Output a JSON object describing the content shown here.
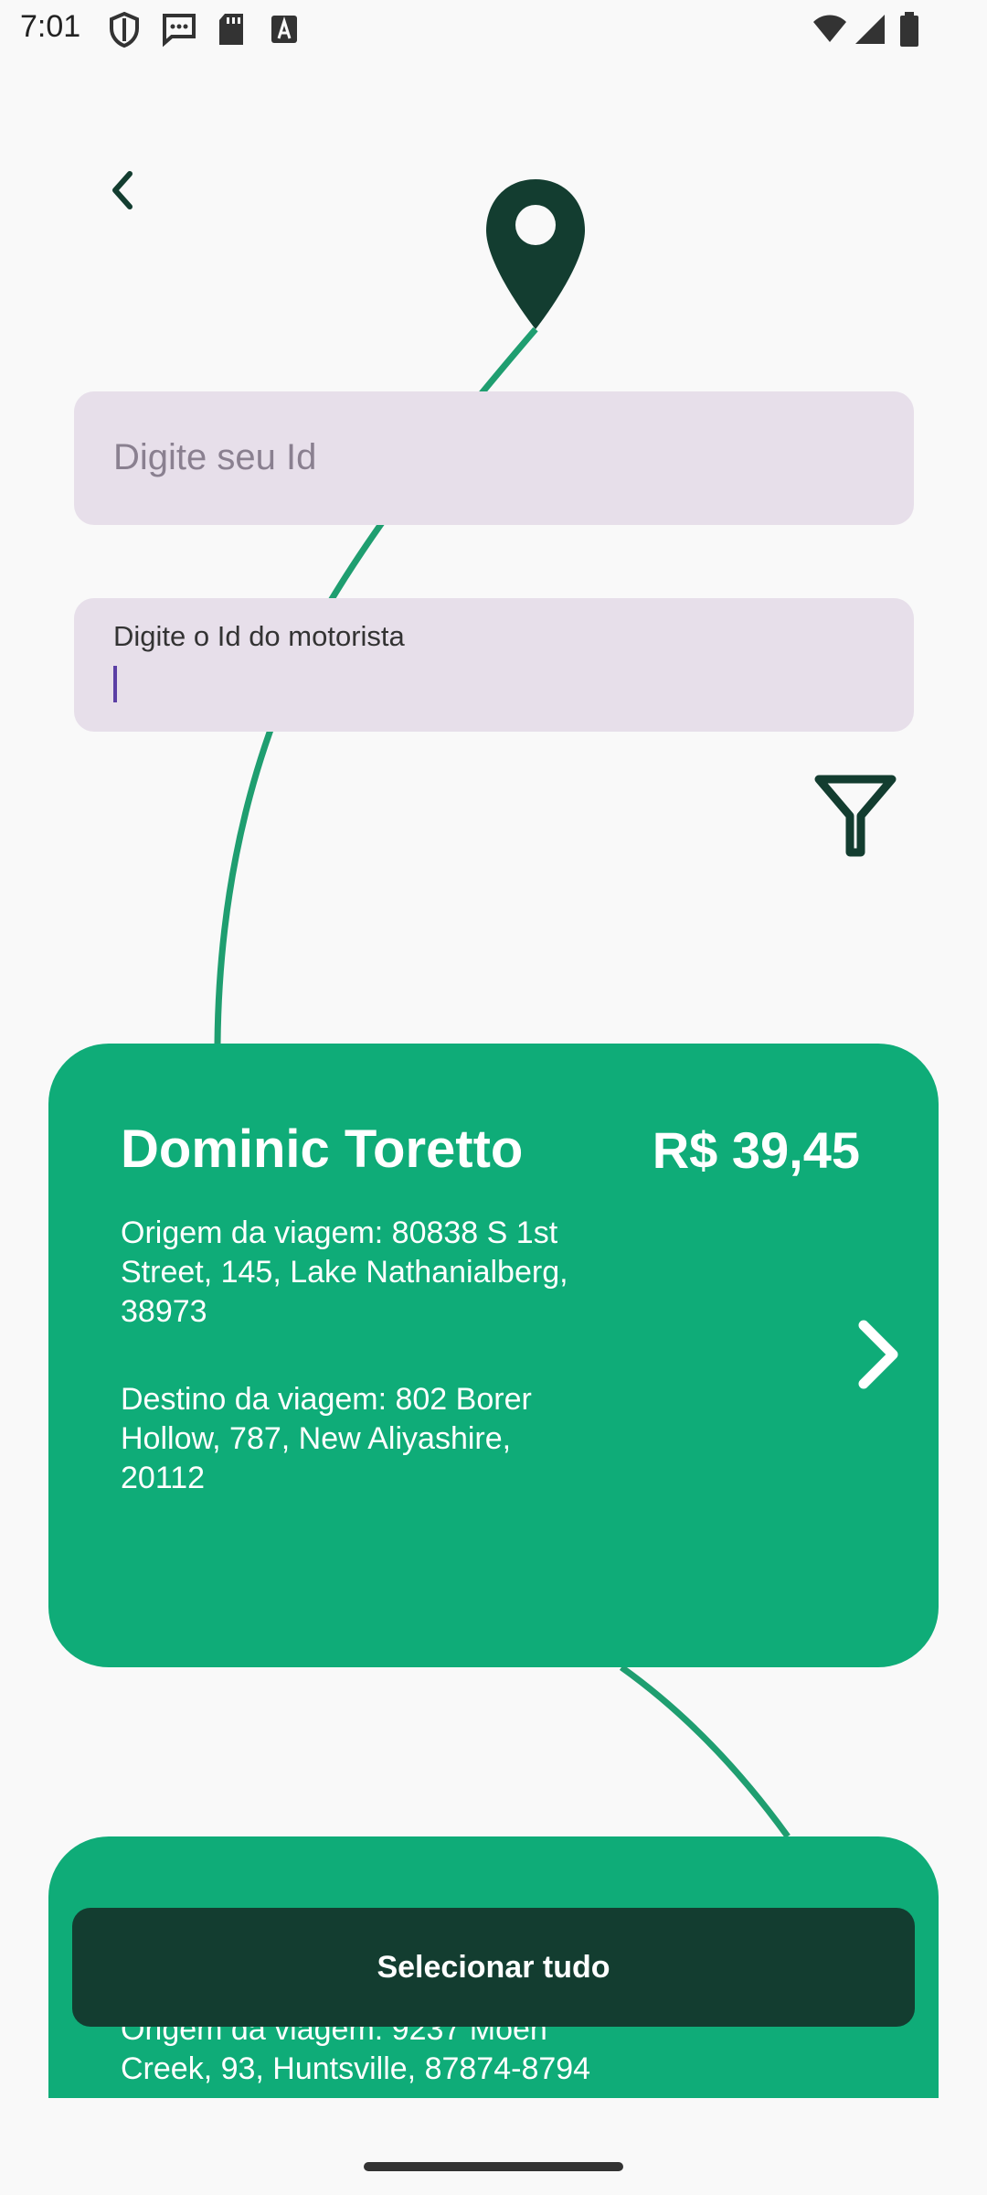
{
  "status_bar": {
    "time": "7:01",
    "left_icons": [
      "shield-icon",
      "message-icon",
      "sd-card-icon",
      "font-icon"
    ],
    "right_icons": [
      "wifi-icon",
      "signal-icon",
      "battery-icon"
    ]
  },
  "colors": {
    "accent": "#0fac78",
    "dark": "#133d30",
    "field_bg": "#e7dfea",
    "caret": "#5b3fa5"
  },
  "header": {
    "back_icon": "chevron-left-icon",
    "pin_icon": "map-pin-icon"
  },
  "form": {
    "user_id": {
      "placeholder": "Digite seu Id",
      "value": ""
    },
    "driver_id": {
      "label": "Digite o Id do motorista",
      "value": ""
    },
    "filter_icon": "filter-icon"
  },
  "rides": [
    {
      "driver": "Dominic Toretto",
      "price": "R$ 39,45",
      "origin": "Origem da viagem: 80838 S 1st Street, 145, Lake Nathanialberg, 38973",
      "destination": "Destino da viagem: 802 Borer Hollow, 787, New Aliyashire, 20112"
    },
    {
      "origin": "Origem da viagem: 9237 Moen Creek, 93, Huntsville, 87874-8794"
    }
  ],
  "actions": {
    "select_all_label": "Selecionar tudo"
  }
}
